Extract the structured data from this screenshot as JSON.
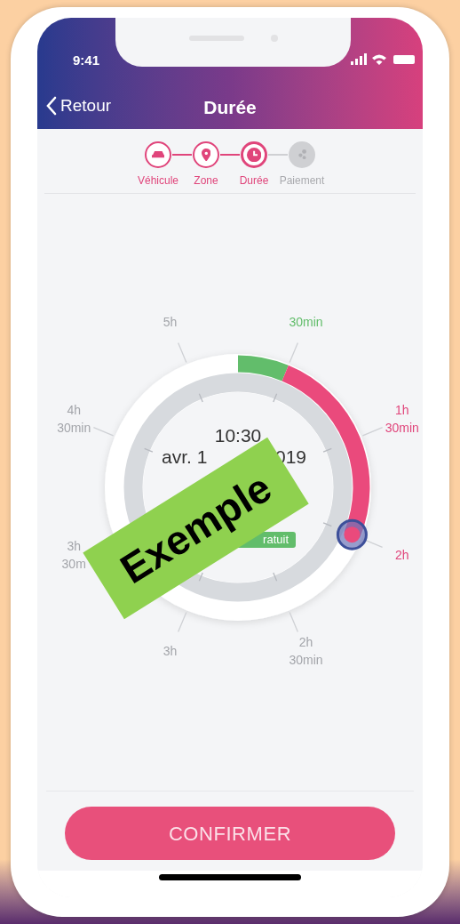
{
  "status_bar": {
    "time": "9:41"
  },
  "nav": {
    "back": "Retour",
    "title": "Durée"
  },
  "steps": [
    {
      "label": "Véhicule",
      "completed": true,
      "current": false
    },
    {
      "label": "Zone",
      "completed": true,
      "current": false
    },
    {
      "label": "Durée",
      "completed": true,
      "current": true
    },
    {
      "label": "Paiement",
      "completed": false,
      "current": false
    }
  ],
  "dial": {
    "ticks": [
      {
        "lines": [
          "30min"
        ],
        "free": true,
        "in_range": false
      },
      {
        "lines": [
          "1h",
          "30min"
        ],
        "free": false,
        "in_range": true
      },
      {
        "lines": [
          "2h"
        ],
        "free": false,
        "in_range": true
      },
      {
        "lines": [
          "2h",
          "30min"
        ],
        "free": false,
        "in_range": false
      },
      {
        "lines": [
          "3h"
        ],
        "free": false,
        "in_range": false
      },
      {
        "lines": [
          "3h",
          "30m"
        ],
        "free": false,
        "in_range": false
      },
      {
        "lines": [
          "4h",
          "30min"
        ],
        "free": false,
        "in_range": false
      },
      {
        "lines": [
          "5h"
        ],
        "free": false,
        "in_range": false
      }
    ],
    "time": "10:30",
    "date_start": "avr. 1",
    "date_end": "019",
    "badge": "ratuit"
  },
  "sticker": "Exemple",
  "confirm_button": "CONFIRMER"
}
